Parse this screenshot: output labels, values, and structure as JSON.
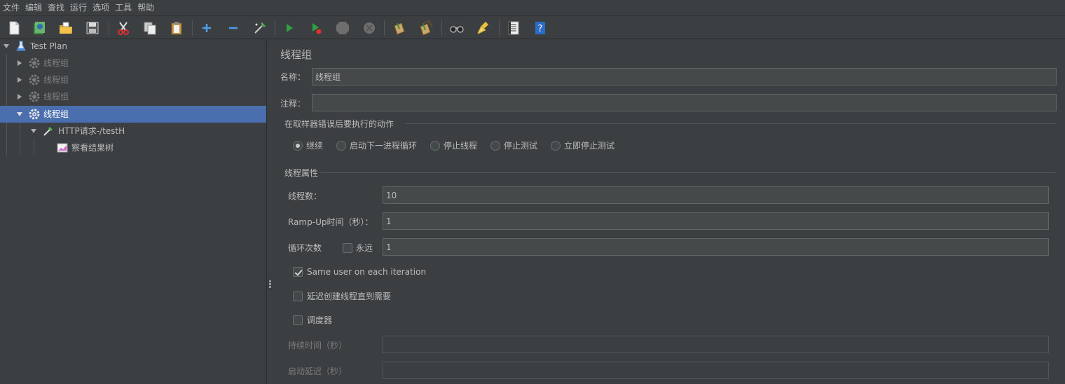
{
  "menu": [
    "文件",
    "编辑",
    "查找",
    "运行",
    "选项",
    "工具",
    "帮助"
  ],
  "toolbar": {
    "icons": [
      "new-icon",
      "templates-icon",
      "open-icon",
      "save-icon",
      "cut-icon",
      "copy-icon",
      "paste-icon",
      "expand-icon",
      "collapse-icon",
      "toggle-icon",
      "start-icon",
      "start-no-pause-icon",
      "stop-icon",
      "shutdown-icon",
      "clear-icon",
      "clear-all-icon",
      "search-icon",
      "reset-search-icon",
      "function-helper-icon",
      "help-icon"
    ]
  },
  "tree": {
    "nodes": [
      {
        "label": "Test Plan",
        "icon": "flask-icon",
        "expanded": true,
        "enabled": true
      },
      {
        "label": "线程组",
        "icon": "gear-icon",
        "expanded": false,
        "enabled": false
      },
      {
        "label": "线程组",
        "icon": "gear-icon",
        "expanded": false,
        "enabled": false
      },
      {
        "label": "线程组",
        "icon": "gear-icon",
        "expanded": false,
        "enabled": false
      },
      {
        "label": "线程组",
        "icon": "gear-icon",
        "expanded": true,
        "enabled": true,
        "selected": true
      },
      {
        "label": "HTTP请求-/testH",
        "icon": "pipette-icon",
        "expanded": true,
        "enabled": true
      },
      {
        "label": "察看结果树",
        "icon": "chart-icon",
        "enabled": true
      }
    ]
  },
  "panel": {
    "title": "线程组",
    "name_label": "名称：",
    "name_value": "线程组",
    "comment_label": "注释：",
    "comment_value": "",
    "error_section": "在取样器错误后要执行的动作",
    "error_actions": [
      {
        "label": "继续",
        "checked": true
      },
      {
        "label": "启动下一进程循环",
        "checked": false
      },
      {
        "label": "停止线程",
        "checked": false
      },
      {
        "label": "停止测试",
        "checked": false
      },
      {
        "label": "立即停止测试",
        "checked": false
      }
    ],
    "props_section": "线程属性",
    "threads_label": "线程数：",
    "threads_value": "10",
    "rampup_label": "Ramp-Up时间（秒）：",
    "rampup_value": "1",
    "loop_label": "循环次数",
    "forever_label": "永远",
    "forever_checked": false,
    "loop_value": "1",
    "same_user_label": "Same user on each iteration",
    "same_user_checked": true,
    "delay_create_label": "延迟创建线程直到需要",
    "delay_create_checked": false,
    "scheduler_label": "调度器",
    "scheduler_checked": false,
    "duration_label": "持续时间（秒）",
    "duration_value": "",
    "startup_delay_label": "启动延迟（秒）",
    "startup_delay_value": ""
  },
  "colors": {
    "background": "#3c3f41",
    "selection": "#4b6eaf",
    "field": "#45494a",
    "text": "#bbbbbb"
  }
}
